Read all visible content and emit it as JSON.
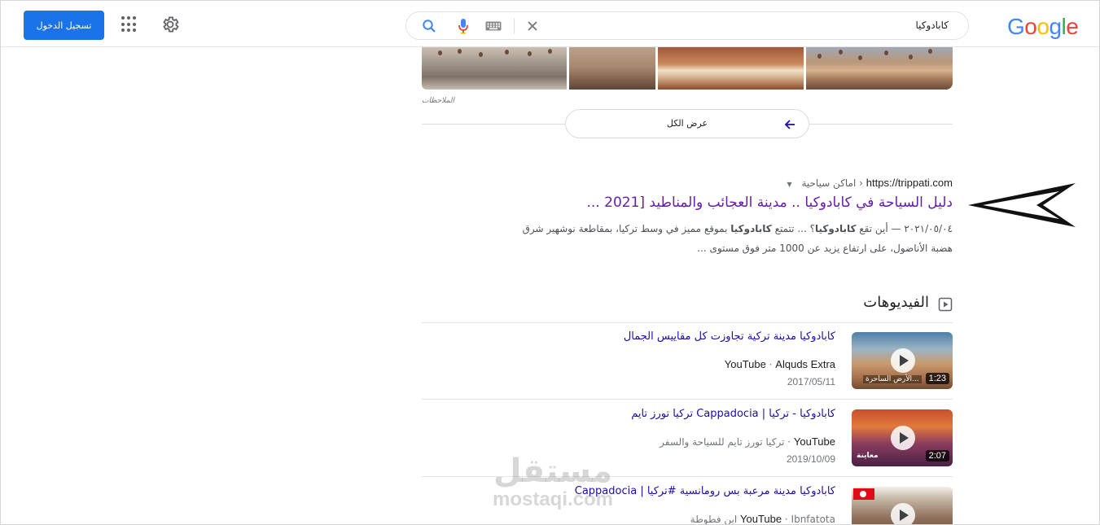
{
  "header": {
    "logo": "Google",
    "search_query": "كابادوكيا",
    "signin_label": "تسجيل الدخول",
    "colors": {
      "accent": "#1a73e8",
      "brand_blue": "#4285f4",
      "brand_red": "#ea4335",
      "brand_yellow": "#fbbc05",
      "brand_green": "#34a853"
    }
  },
  "images": {
    "notes_label": "الملاحظات",
    "view_all_label": "عرض الكل"
  },
  "result": {
    "url": "https://trippati.com",
    "breadcrumb": "اماكن سياحية",
    "title": "دليل السياحة في كابادوكيا .. مدينة العجائب والمناطيد [2021 ...",
    "date": "٢٠٢١/٠٥/٠٤",
    "snippet_1": "أين تقع",
    "snippet_bold_1": "كابادوكيا",
    "snippet_2": "؟ ... تتمتع",
    "snippet_bold_2": "كابادوكيا",
    "snippet_3": "بموقع مميز في وسط تركيا، بمقاطعة نوشهير شرق",
    "snippet_line_2": "هضبة الأناضول، على ارتفاع يزيد عن 1000 متر فوق مستوى ..."
  },
  "videos": {
    "heading": "الفيديوهات",
    "items": [
      {
        "title": "كابادوكيا مدينة تركية تجاوزت كل مقاييس الجمال",
        "source": "YouTube",
        "channel": "Alquds Extra",
        "date": "2017/05/11",
        "duration": "1:23",
        "thumb_caption": "...الأرض الساحرة"
      },
      {
        "title": "كابادوكيا - تركيا | Cappadocia تركيا تورز تايم",
        "source": "YouTube",
        "channel": "تركيا تورز تايم للسياحة والسفر",
        "date": "2019/10/09",
        "duration": "2:07",
        "thumb_caption": "معاينة"
      },
      {
        "title": "كابادوكيا مدينة مرعبة بس رومانسية #تركيا | Cappadocia",
        "source": "YouTube",
        "channel": "Ibnfatota ابن فطوطة",
        "date": "",
        "duration": "",
        "thumb_caption": ""
      }
    ]
  },
  "watermark": {
    "arabic": "مستقل",
    "latin": "mostaqi.com"
  }
}
